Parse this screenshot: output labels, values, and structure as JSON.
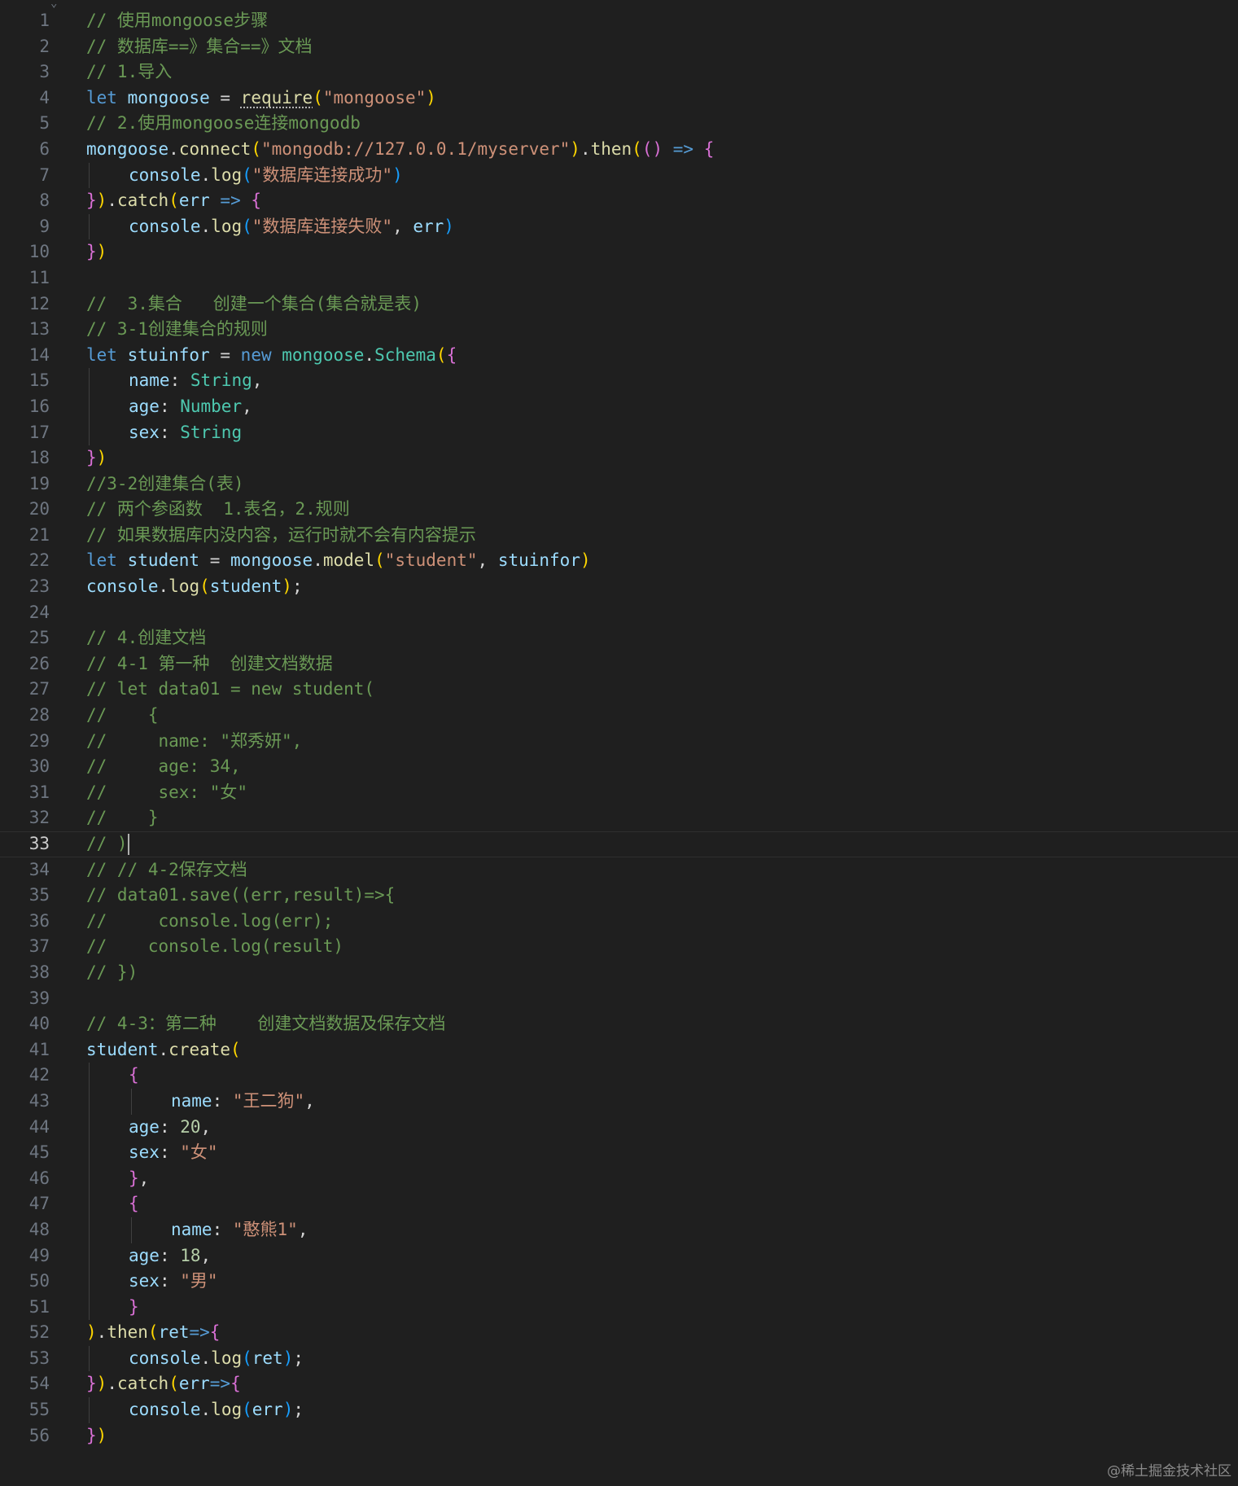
{
  "editor": {
    "active_line": 33,
    "colors": {
      "background": "#1f1f1f",
      "comment": "#6a9955",
      "keyword": "#569cd6",
      "variable": "#9cdcfe",
      "function": "#dcdcaa",
      "string": "#ce9178",
      "type": "#4ec9b0",
      "number": "#b5cea8"
    },
    "lines": [
      {
        "n": "1",
        "indent": 0,
        "tokens": [
          [
            "cm",
            "// 使用mongoose步骤"
          ]
        ]
      },
      {
        "n": "2",
        "indent": 0,
        "tokens": [
          [
            "cm",
            "// 数据库==》集合==》文档"
          ]
        ]
      },
      {
        "n": "3",
        "indent": 0,
        "tokens": [
          [
            "cm",
            "// 1.导入"
          ]
        ]
      },
      {
        "n": "4",
        "indent": 0,
        "tokens": [
          [
            "kw",
            "let "
          ],
          [
            "var",
            "mongoose"
          ],
          [
            "op",
            " = "
          ],
          [
            "fn-sq",
            "require"
          ],
          [
            "p1",
            "("
          ],
          [
            "str",
            "\"mongoose\""
          ],
          [
            "p1",
            ")"
          ]
        ]
      },
      {
        "n": "5",
        "indent": 0,
        "tokens": [
          [
            "cm",
            "// 2.使用mongoose连接mongodb"
          ]
        ]
      },
      {
        "n": "6",
        "indent": 0,
        "tokens": [
          [
            "var",
            "mongoose"
          ],
          [
            "op",
            "."
          ],
          [
            "fn",
            "connect"
          ],
          [
            "p1",
            "("
          ],
          [
            "str",
            "\"mongodb://127.0.0.1/myserver\""
          ],
          [
            "p1",
            ")"
          ],
          [
            "op",
            "."
          ],
          [
            "fn",
            "then"
          ],
          [
            "p1",
            "("
          ],
          [
            "p2",
            "()"
          ],
          [
            "kw",
            " => "
          ],
          [
            "p2",
            "{"
          ]
        ]
      },
      {
        "n": "7",
        "indent": 1,
        "tokens": [
          [
            "var",
            "console"
          ],
          [
            "op",
            "."
          ],
          [
            "fn",
            "log"
          ],
          [
            "p3",
            "("
          ],
          [
            "str",
            "\"数据库连接成功\""
          ],
          [
            "p3",
            ")"
          ]
        ]
      },
      {
        "n": "8",
        "indent": 0,
        "tokens": [
          [
            "p2",
            "}"
          ],
          [
            "p1",
            ")"
          ],
          [
            "op",
            "."
          ],
          [
            "fn",
            "catch"
          ],
          [
            "p1",
            "("
          ],
          [
            "var",
            "err"
          ],
          [
            "kw",
            " => "
          ],
          [
            "p2",
            "{"
          ]
        ]
      },
      {
        "n": "9",
        "indent": 1,
        "tokens": [
          [
            "var",
            "console"
          ],
          [
            "op",
            "."
          ],
          [
            "fn",
            "log"
          ],
          [
            "p3",
            "("
          ],
          [
            "str",
            "\"数据库连接失败\""
          ],
          [
            "op",
            ", "
          ],
          [
            "var",
            "err"
          ],
          [
            "p3",
            ")"
          ]
        ]
      },
      {
        "n": "10",
        "indent": 0,
        "tokens": [
          [
            "p2",
            "}"
          ],
          [
            "p1",
            ")"
          ]
        ]
      },
      {
        "n": "11",
        "indent": 0,
        "tokens": []
      },
      {
        "n": "12",
        "indent": 0,
        "tokens": [
          [
            "cm",
            "//  3.集合   创建一个集合(集合就是表)"
          ]
        ]
      },
      {
        "n": "13",
        "indent": 0,
        "tokens": [
          [
            "cm",
            "// 3-1创建集合的规则"
          ]
        ]
      },
      {
        "n": "14",
        "indent": 0,
        "tokens": [
          [
            "kw",
            "let "
          ],
          [
            "var",
            "stuinfor"
          ],
          [
            "op",
            " = "
          ],
          [
            "kw",
            "new "
          ],
          [
            "type",
            "mongoose"
          ],
          [
            "op",
            "."
          ],
          [
            "type",
            "Schema"
          ],
          [
            "p1",
            "("
          ],
          [
            "p2",
            "{"
          ]
        ]
      },
      {
        "n": "15",
        "indent": 1,
        "tokens": [
          [
            "var",
            "name"
          ],
          [
            "op",
            ": "
          ],
          [
            "type",
            "String"
          ],
          [
            "op",
            ","
          ]
        ]
      },
      {
        "n": "16",
        "indent": 1,
        "tokens": [
          [
            "var",
            "age"
          ],
          [
            "op",
            ": "
          ],
          [
            "type",
            "Number"
          ],
          [
            "op",
            ","
          ]
        ]
      },
      {
        "n": "17",
        "indent": 1,
        "tokens": [
          [
            "var",
            "sex"
          ],
          [
            "op",
            ": "
          ],
          [
            "type",
            "String"
          ]
        ]
      },
      {
        "n": "18",
        "indent": 0,
        "tokens": [
          [
            "p2",
            "}"
          ],
          [
            "p1",
            ")"
          ]
        ]
      },
      {
        "n": "19",
        "indent": 0,
        "tokens": [
          [
            "cm",
            "//3-2创建集合(表)"
          ]
        ]
      },
      {
        "n": "20",
        "indent": 0,
        "tokens": [
          [
            "cm",
            "// 两个参函数  1.表名，2.规则"
          ]
        ]
      },
      {
        "n": "21",
        "indent": 0,
        "tokens": [
          [
            "cm",
            "// 如果数据库内没内容，运行时就不会有内容提示"
          ]
        ]
      },
      {
        "n": "22",
        "indent": 0,
        "tokens": [
          [
            "kw",
            "let "
          ],
          [
            "var",
            "student"
          ],
          [
            "op",
            " = "
          ],
          [
            "var",
            "mongoose"
          ],
          [
            "op",
            "."
          ],
          [
            "fn",
            "model"
          ],
          [
            "p1",
            "("
          ],
          [
            "str",
            "\"student\""
          ],
          [
            "op",
            ", "
          ],
          [
            "var",
            "stuinfor"
          ],
          [
            "p1",
            ")"
          ]
        ]
      },
      {
        "n": "23",
        "indent": 0,
        "tokens": [
          [
            "var",
            "console"
          ],
          [
            "op",
            "."
          ],
          [
            "fn",
            "log"
          ],
          [
            "p1",
            "("
          ],
          [
            "var",
            "student"
          ],
          [
            "p1",
            ")"
          ],
          [
            "op",
            ";"
          ]
        ]
      },
      {
        "n": "24",
        "indent": 0,
        "tokens": []
      },
      {
        "n": "25",
        "indent": 0,
        "tokens": [
          [
            "cm",
            "// 4.创建文档"
          ]
        ]
      },
      {
        "n": "26",
        "indent": 0,
        "tokens": [
          [
            "cm",
            "// 4-1 第一种  创建文档数据"
          ]
        ]
      },
      {
        "n": "27",
        "indent": 0,
        "tokens": [
          [
            "cm",
            "// let data01 = new student("
          ]
        ]
      },
      {
        "n": "28",
        "indent": 0,
        "tokens": [
          [
            "cm",
            "//    {"
          ]
        ]
      },
      {
        "n": "29",
        "indent": 0,
        "tokens": [
          [
            "cm",
            "//     name: \"郑秀妍\","
          ]
        ]
      },
      {
        "n": "30",
        "indent": 0,
        "tokens": [
          [
            "cm",
            "//     age: 34,"
          ]
        ]
      },
      {
        "n": "31",
        "indent": 0,
        "tokens": [
          [
            "cm",
            "//     sex: \"女\""
          ]
        ]
      },
      {
        "n": "32",
        "indent": 0,
        "tokens": [
          [
            "cm",
            "//    }"
          ]
        ]
      },
      {
        "n": "33",
        "indent": 0,
        "tokens": [
          [
            "cm",
            "// )"
          ]
        ],
        "cursor": true
      },
      {
        "n": "34",
        "indent": 0,
        "tokens": [
          [
            "cm",
            "// // 4-2保存文档"
          ]
        ]
      },
      {
        "n": "35",
        "indent": 0,
        "tokens": [
          [
            "cm",
            "// data01.save((err,result)=>{"
          ]
        ]
      },
      {
        "n": "36",
        "indent": 0,
        "tokens": [
          [
            "cm",
            "//     console.log(err);"
          ]
        ]
      },
      {
        "n": "37",
        "indent": 0,
        "tokens": [
          [
            "cm",
            "//    console.log(result)"
          ]
        ]
      },
      {
        "n": "38",
        "indent": 0,
        "tokens": [
          [
            "cm",
            "// })"
          ]
        ]
      },
      {
        "n": "39",
        "indent": 0,
        "tokens": []
      },
      {
        "n": "40",
        "indent": 0,
        "tokens": [
          [
            "cm",
            "// 4-3：第二种    创建文档数据及保存文档"
          ]
        ]
      },
      {
        "n": "41",
        "indent": 0,
        "tokens": [
          [
            "var",
            "student"
          ],
          [
            "op",
            "."
          ],
          [
            "fn",
            "create"
          ],
          [
            "p1",
            "("
          ]
        ]
      },
      {
        "n": "42",
        "indent": 1,
        "tokens": [
          [
            "p2",
            "{"
          ]
        ]
      },
      {
        "n": "43",
        "indent": 2,
        "tokens": [
          [
            "var",
            "name"
          ],
          [
            "op",
            ": "
          ],
          [
            "str",
            "\"王二狗\""
          ],
          [
            "op",
            ","
          ]
        ]
      },
      {
        "n": "44",
        "indent": 1,
        "tokens": [
          [
            "var",
            "age"
          ],
          [
            "op",
            ": "
          ],
          [
            "num",
            "20"
          ],
          [
            "op",
            ","
          ]
        ]
      },
      {
        "n": "45",
        "indent": 1,
        "tokens": [
          [
            "var",
            "sex"
          ],
          [
            "op",
            ": "
          ],
          [
            "str",
            "\"女\""
          ]
        ]
      },
      {
        "n": "46",
        "indent": 1,
        "tokens": [
          [
            "p2",
            "}"
          ],
          [
            "op",
            ","
          ]
        ]
      },
      {
        "n": "47",
        "indent": 1,
        "tokens": [
          [
            "p2",
            "{"
          ]
        ]
      },
      {
        "n": "48",
        "indent": 2,
        "tokens": [
          [
            "var",
            "name"
          ],
          [
            "op",
            ": "
          ],
          [
            "str",
            "\"憨熊1\""
          ],
          [
            "op",
            ","
          ]
        ]
      },
      {
        "n": "49",
        "indent": 1,
        "tokens": [
          [
            "var",
            "age"
          ],
          [
            "op",
            ": "
          ],
          [
            "num",
            "18"
          ],
          [
            "op",
            ","
          ]
        ]
      },
      {
        "n": "50",
        "indent": 1,
        "tokens": [
          [
            "var",
            "sex"
          ],
          [
            "op",
            ": "
          ],
          [
            "str",
            "\"男\""
          ]
        ]
      },
      {
        "n": "51",
        "indent": 1,
        "tokens": [
          [
            "p2",
            "}"
          ]
        ]
      },
      {
        "n": "52",
        "indent": 0,
        "tokens": [
          [
            "p1",
            ")"
          ],
          [
            "op",
            "."
          ],
          [
            "fn",
            "then"
          ],
          [
            "p1",
            "("
          ],
          [
            "var",
            "ret"
          ],
          [
            "kw",
            "=>"
          ],
          [
            "p2",
            "{"
          ]
        ]
      },
      {
        "n": "53",
        "indent": 1,
        "tokens": [
          [
            "var",
            "console"
          ],
          [
            "op",
            "."
          ],
          [
            "fn",
            "log"
          ],
          [
            "p3",
            "("
          ],
          [
            "var",
            "ret"
          ],
          [
            "p3",
            ")"
          ],
          [
            "op",
            ";"
          ]
        ]
      },
      {
        "n": "54",
        "indent": 0,
        "tokens": [
          [
            "p2",
            "}"
          ],
          [
            "p1",
            ")"
          ],
          [
            "op",
            "."
          ],
          [
            "fn",
            "catch"
          ],
          [
            "p1",
            "("
          ],
          [
            "var",
            "err"
          ],
          [
            "kw",
            "=>"
          ],
          [
            "p2",
            "{"
          ]
        ]
      },
      {
        "n": "55",
        "indent": 1,
        "tokens": [
          [
            "var",
            "console"
          ],
          [
            "op",
            "."
          ],
          [
            "fn",
            "log"
          ],
          [
            "p3",
            "("
          ],
          [
            "var",
            "err"
          ],
          [
            "p3",
            ")"
          ],
          [
            "op",
            ";"
          ]
        ]
      },
      {
        "n": "56",
        "indent": 0,
        "tokens": [
          [
            "p2",
            "}"
          ],
          [
            "p1",
            ")"
          ]
        ]
      }
    ]
  },
  "watermark": "@稀土掘金技术社区"
}
